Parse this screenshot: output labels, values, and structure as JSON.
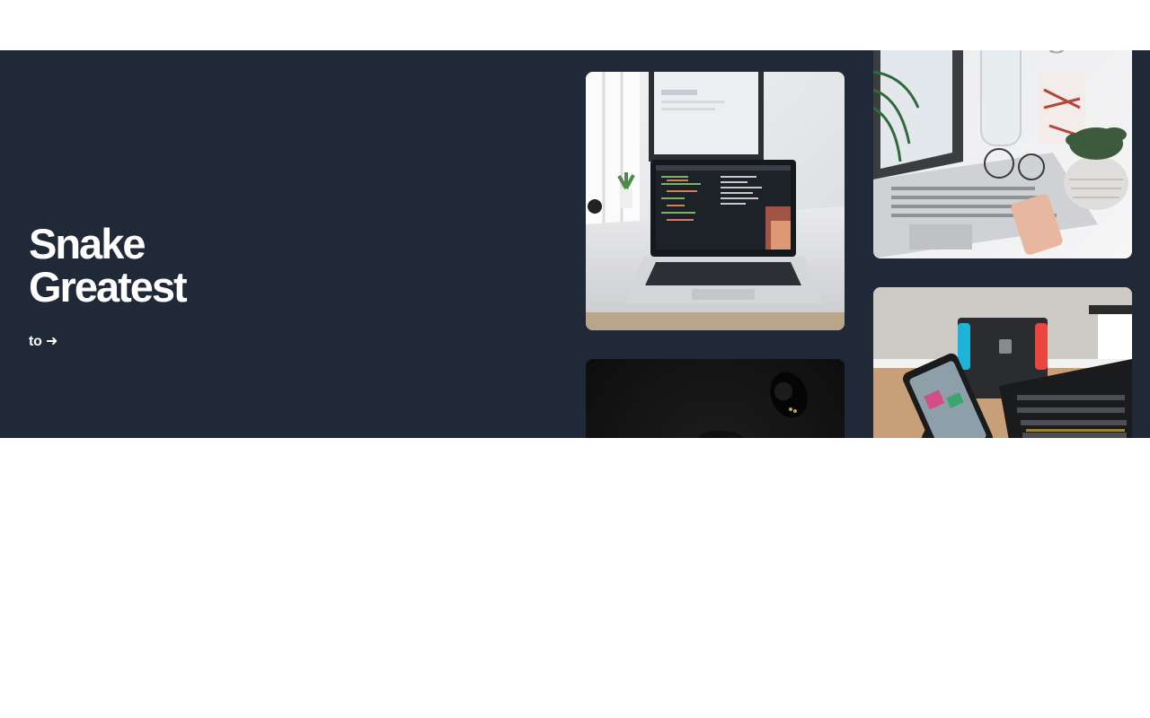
{
  "hero": {
    "title_line_1": "Snake",
    "title_line_2": "Greatest",
    "link_text": "to ➜"
  },
  "colors": {
    "hero_background": "#1f2937",
    "hero_text": "#ffffff",
    "page_background": "#ffffff"
  },
  "gallery": {
    "images": [
      {
        "name": "laptop-code-desk-image"
      },
      {
        "name": "dark-earbuds-image"
      },
      {
        "name": "silver-laptop-desk-image"
      },
      {
        "name": "gaming-setup-phone-image"
      }
    ]
  }
}
